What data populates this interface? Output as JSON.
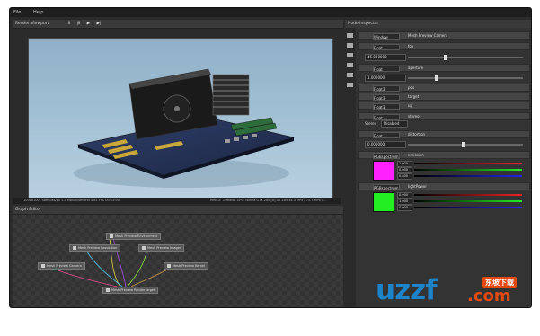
{
  "menu": {
    "file": "File",
    "help": "Help"
  },
  "render_panel": {
    "title": "Render Viewport",
    "toolbar": [
      "Ⅱ",
      "|Ⅱ",
      "▶",
      "▶|"
    ],
    "status_left": "1001x1001 samples/px   1.4 Mpixel/second   4.81 FPS   00:05:00",
    "status_right": "MMCU: Threads: GPU: Nvidia GTX 285 [8]  GT 285  44.3 MPx / 75.7 MPx / ..."
  },
  "graph_panel": {
    "title": "Graph Editor",
    "nodes": [
      {
        "id": "n1",
        "label": "Mesh Preview Environment"
      },
      {
        "id": "n2",
        "label": "Mesh Preview Resolution"
      },
      {
        "id": "n3",
        "label": "Mesh Preview Imager"
      },
      {
        "id": "n4",
        "label": "Mesh Preview Camera"
      },
      {
        "id": "n5",
        "label": "Mesh Preview Kernel"
      },
      {
        "id": "n6",
        "label": "Mesh Preview RenderTarget"
      }
    ]
  },
  "inspector": {
    "title": "Node Inspector",
    "rows": [
      {
        "type": "Window",
        "label": "Mesh Preview Camera"
      },
      {
        "type": "Float",
        "label": "fov"
      },
      {
        "type": "Float",
        "label": "aperture"
      },
      {
        "type": "Float3",
        "label": "pos"
      },
      {
        "type": "Float3",
        "label": "target"
      },
      {
        "type": "Float3",
        "label": "up"
      },
      {
        "type": "Float",
        "label": "stereo"
      },
      {
        "type": "Float",
        "label": "distortion"
      },
      {
        "type": "RGBspectrum",
        "label": "emission"
      },
      {
        "type": "RGBspectrum",
        "label": "lightPower"
      }
    ],
    "values": {
      "fov": "45.000000",
      "aperture": "1.000000",
      "stereo": "Stereo",
      "stereo_val": "Disabled",
      "distortion": "0.000000",
      "emission_r": "1.000",
      "emission_g": "0.000",
      "emission_b": "0.800",
      "light_r": "0.000",
      "light_g": "1.000",
      "light_b": "0.000"
    },
    "colors": {
      "emission": "#ff22ff",
      "light": "#22ee22"
    }
  },
  "watermark": {
    "text": "uzzf",
    "suffix": ".com",
    "badge": "东坡下载"
  }
}
